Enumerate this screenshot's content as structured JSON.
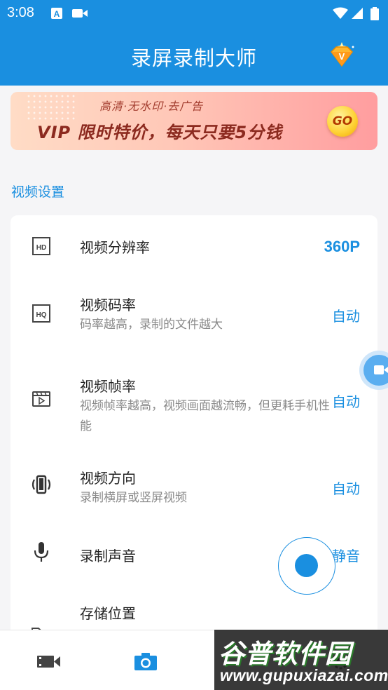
{
  "status_bar": {
    "time": "3:08",
    "icons": [
      "notification-a-icon",
      "screen-record-icon",
      "wifi-icon",
      "signal-icon",
      "battery-icon"
    ]
  },
  "header": {
    "title": "录屏录制大师",
    "vip_icon": "vip-diamond-icon"
  },
  "banner": {
    "subtitle": "高清·无水印·去广告",
    "main_text": "VIP 限时特价，每天只要5分钱",
    "go_label": "GO"
  },
  "section": {
    "title": "视频设置"
  },
  "settings": [
    {
      "icon": "hd-icon",
      "label": "视频分辨率",
      "desc": "",
      "value": "360P"
    },
    {
      "icon": "hq-icon",
      "label": "视频码率",
      "desc": "码率越高，录制的文件越大",
      "value": "自动"
    },
    {
      "icon": "clapper-icon",
      "label": "视频帧率",
      "desc": "视频帧率越高，视频画面越流畅，但更耗手机性能",
      "value": "自动"
    },
    {
      "icon": "screen-rotation-icon",
      "label": "视频方向",
      "desc": "录制横屏或竖屏视频",
      "value": "自动"
    },
    {
      "icon": "microphone-icon",
      "label": "录制声音",
      "desc": "",
      "value": "静音"
    },
    {
      "icon": "folder-icon",
      "label": "存储位置",
      "desc": "",
      "value": ""
    }
  ],
  "bottom_nav": [
    {
      "icon": "video-camera-icon",
      "active": false
    },
    {
      "icon": "camera-icon",
      "active": true
    },
    {
      "icon": "settings-icon",
      "active": false
    }
  ],
  "watermark": {
    "name": "谷普软件园",
    "url": "www.gupuxiazai.com"
  },
  "colors": {
    "primary": "#1a8fe0",
    "background": "#f5f5f7",
    "text": "#222222",
    "secondary_text": "#8a8a8a"
  }
}
